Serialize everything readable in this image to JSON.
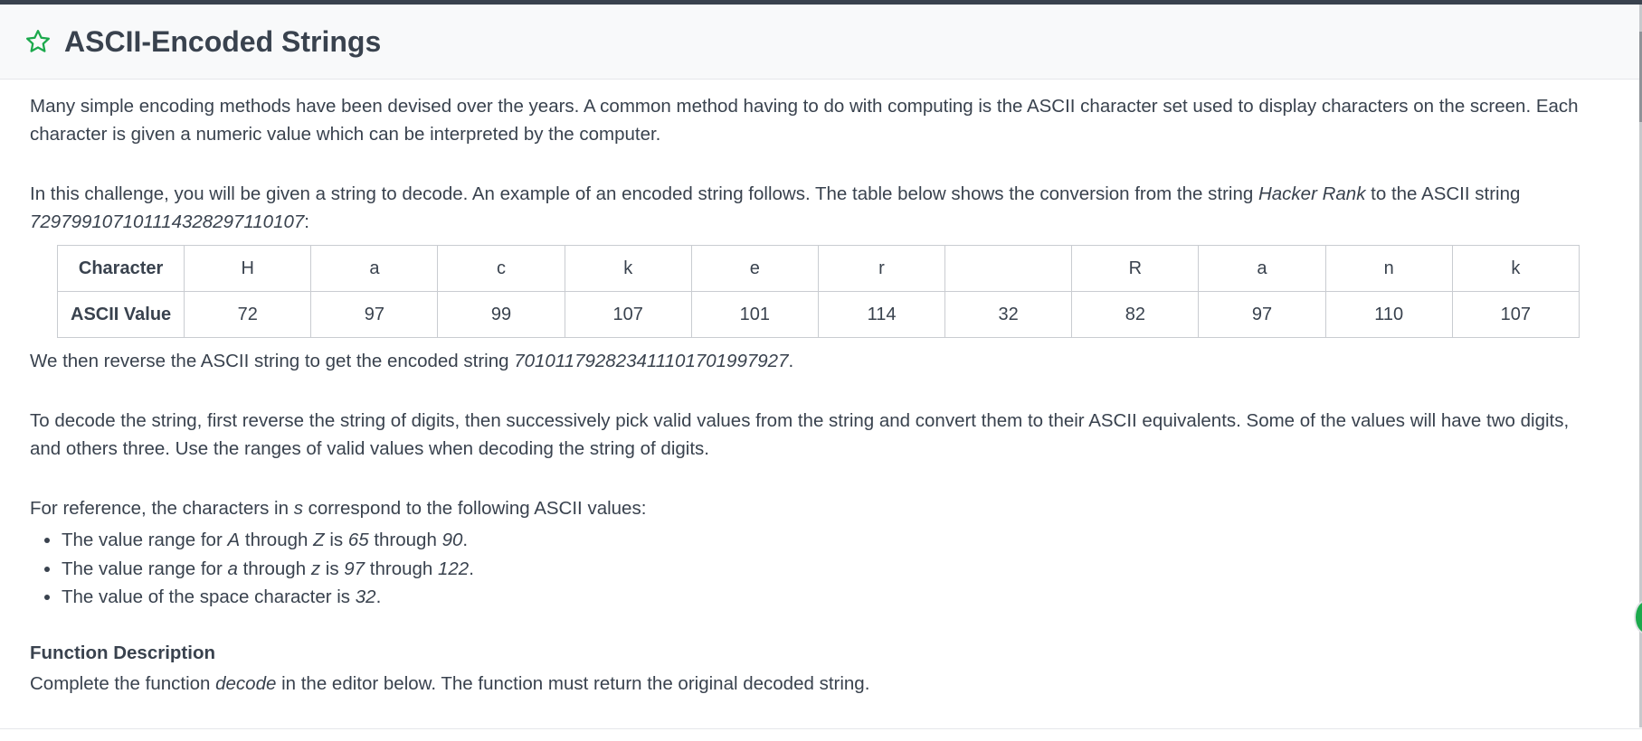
{
  "header": {
    "title": "ASCII-Encoded Strings"
  },
  "intro": {
    "p1": "Many simple encoding methods have been devised over the years. A common method having to do with computing is the ASCII character set used to display characters on the screen. Each character is given a numeric value which can be interpreted by the computer.",
    "p2_a": "In this challenge, you will be given a string to decode. An example of an encoded string follows. The table below shows the conversion from the string ",
    "p2_b": "Hacker Rank",
    "p2_c": " to the ASCII string ",
    "p2_d": "729799107101114328297110107",
    "p2_e": ":"
  },
  "table": {
    "row_headers": [
      "Character",
      "ASCII Value"
    ],
    "characters": [
      "H",
      "a",
      "c",
      "k",
      "e",
      "r",
      " ",
      "R",
      "a",
      "n",
      "k"
    ],
    "values": [
      "72",
      "97",
      "99",
      "107",
      "101",
      "114",
      "32",
      "82",
      "97",
      "110",
      "107"
    ]
  },
  "reverse": {
    "a": "We then reverse the ASCII string to get the encoded string ",
    "b": "701011792823411101701997927",
    "c": "."
  },
  "decode": {
    "text": "To decode the string, first reverse the string of digits, then successively pick valid values from the string and convert them to their ASCII equivalents. Some of the values will have two digits, and others three. Use the ranges of valid values when decoding the string of digits."
  },
  "reference": {
    "a": "For reference, the characters in ",
    "b": "s",
    "c": " correspond to the following ASCII values:"
  },
  "ranges": [
    {
      "t1": "The value range for ",
      "t2": "A",
      "t3": " through ",
      "t4": "Z",
      "t5": " is ",
      "t6": "65",
      "t7": " through ",
      "t8": "90",
      "t9": "."
    },
    {
      "t1": "The value range for ",
      "t2": "a",
      "t3": " through ",
      "t4": "z",
      "t5": " is ",
      "t6": "97",
      "t7": " through ",
      "t8": "122",
      "t9": "."
    },
    {
      "t1": "The value of the space character is ",
      "t2": "32",
      "t3": "."
    }
  ],
  "function_description": {
    "heading": "Function Description",
    "a": "Complete the function ",
    "b": "decode",
    "c": " in the editor below. The function must return the original decoded string."
  },
  "colors": {
    "accent": "#1ba94c",
    "text": "#39424e",
    "header_bg": "#f8f9fa"
  },
  "icons": [
    "star-outline-icon"
  ]
}
